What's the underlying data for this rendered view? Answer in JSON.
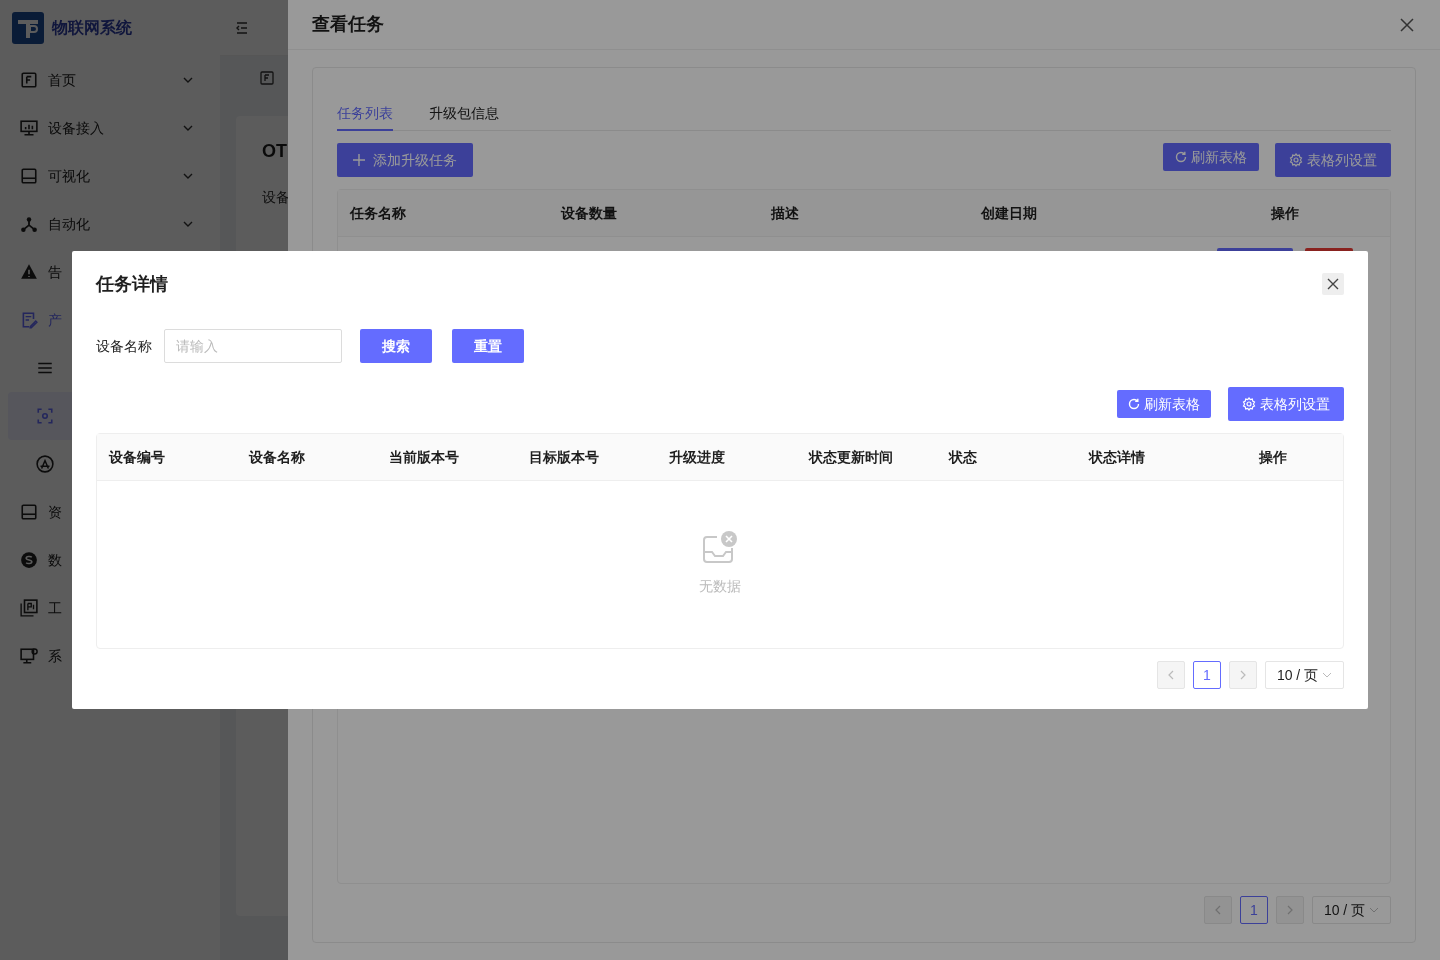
{
  "sidebar": {
    "title": "物联网系统",
    "items": [
      {
        "label": "首页",
        "selected": false,
        "expanded": false
      },
      {
        "label": "设备接入",
        "selected": false,
        "expanded": false
      },
      {
        "label": "可视化",
        "selected": false,
        "expanded": false
      },
      {
        "label": "自动化",
        "selected": false,
        "expanded": false
      },
      {
        "label": "告",
        "selected": false
      },
      {
        "label": "产",
        "selected": true,
        "children": [
          {
            "selected": false
          },
          {
            "selected": true
          },
          {
            "selected": false
          }
        ]
      },
      {
        "label": "资",
        "selected": false
      },
      {
        "label": "数",
        "selected": false
      },
      {
        "label": "工",
        "selected": false
      },
      {
        "label": "系",
        "selected": false
      }
    ]
  },
  "page": {
    "card_title": "OT",
    "field_label": "设备"
  },
  "drawer": {
    "title": "查看任务",
    "tabs": [
      {
        "label": "任务列表",
        "selected": true
      },
      {
        "label": "升级包信息",
        "selected": false
      }
    ],
    "add_button": "添加升级任务",
    "refresh_button": "刷新表格",
    "columns_button": "表格列设置",
    "columns": [
      "任务名称",
      "设备数量",
      "描述",
      "创建日期",
      "操作"
    ],
    "pagination": {
      "page": "1",
      "page_size": "10 / 页"
    }
  },
  "modal": {
    "title": "任务详情",
    "filter": {
      "label": "设备名称",
      "placeholder": "请输入"
    },
    "search_button": "搜索",
    "reset_button": "重置",
    "refresh_button": "刷新表格",
    "columns_button": "表格列设置",
    "columns": [
      "设备编号",
      "设备名称",
      "当前版本号",
      "目标版本号",
      "升级进度",
      "状态更新时间",
      "状态",
      "状态详情",
      "操作"
    ],
    "empty_text": "无数据",
    "pagination": {
      "page": "1",
      "page_size": "10 / 页"
    }
  }
}
